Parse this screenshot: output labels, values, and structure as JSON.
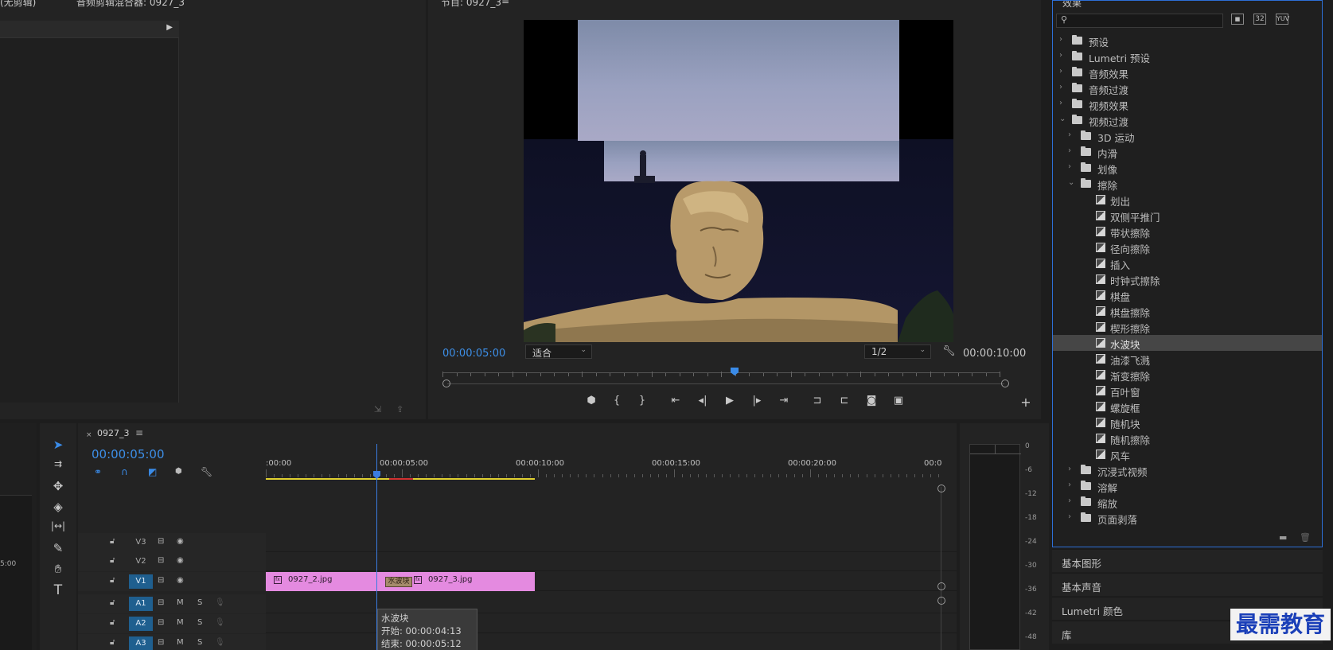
{
  "source": {
    "tab1": "(无剪辑)",
    "tab2": "音频剪辑混合器: 0927_3"
  },
  "program": {
    "title": "节目: 0927_3",
    "menu_icon": "≡",
    "timecode_current": "00:00:05:00",
    "timecode_duration": "00:00:10:00",
    "fit_label": "适合",
    "resolution_label": "1/2"
  },
  "effects": {
    "title": "效果",
    "search_placeholder": "",
    "tree": [
      {
        "label": "预设",
        "level": 0,
        "type": "folder",
        "expanded": false
      },
      {
        "label": "Lumetri 预设",
        "level": 0,
        "type": "folder",
        "expanded": false
      },
      {
        "label": "音频效果",
        "level": 0,
        "type": "folder",
        "expanded": false
      },
      {
        "label": "音频过渡",
        "level": 0,
        "type": "folder",
        "expanded": false
      },
      {
        "label": "视频效果",
        "level": 0,
        "type": "folder",
        "expanded": false
      },
      {
        "label": "视频过渡",
        "level": 0,
        "type": "folder",
        "expanded": true
      },
      {
        "label": "3D 运动",
        "level": 1,
        "type": "folder",
        "expanded": false
      },
      {
        "label": "内滑",
        "level": 1,
        "type": "folder",
        "expanded": false
      },
      {
        "label": "划像",
        "level": 1,
        "type": "folder",
        "expanded": false
      },
      {
        "label": "擦除",
        "level": 1,
        "type": "folder",
        "expanded": true
      },
      {
        "label": "划出",
        "level": 2,
        "type": "effect"
      },
      {
        "label": "双侧平推门",
        "level": 2,
        "type": "effect"
      },
      {
        "label": "带状擦除",
        "level": 2,
        "type": "effect"
      },
      {
        "label": "径向擦除",
        "level": 2,
        "type": "effect"
      },
      {
        "label": "插入",
        "level": 2,
        "type": "effect"
      },
      {
        "label": "时钟式擦除",
        "level": 2,
        "type": "effect"
      },
      {
        "label": "棋盘",
        "level": 2,
        "type": "effect"
      },
      {
        "label": "棋盘擦除",
        "level": 2,
        "type": "effect"
      },
      {
        "label": "楔形擦除",
        "level": 2,
        "type": "effect"
      },
      {
        "label": "水波块",
        "level": 2,
        "type": "effect",
        "selected": true
      },
      {
        "label": "油漆飞溅",
        "level": 2,
        "type": "effect"
      },
      {
        "label": "渐变擦除",
        "level": 2,
        "type": "effect"
      },
      {
        "label": "百叶窗",
        "level": 2,
        "type": "effect"
      },
      {
        "label": "螺旋框",
        "level": 2,
        "type": "effect"
      },
      {
        "label": "随机块",
        "level": 2,
        "type": "effect"
      },
      {
        "label": "随机擦除",
        "level": 2,
        "type": "effect"
      },
      {
        "label": "风车",
        "level": 2,
        "type": "effect"
      },
      {
        "label": "沉浸式视频",
        "level": 1,
        "type": "folder",
        "expanded": false
      },
      {
        "label": "溶解",
        "level": 1,
        "type": "folder",
        "expanded": false
      },
      {
        "label": "缩放",
        "level": 1,
        "type": "folder",
        "expanded": false
      },
      {
        "label": "页面剥落",
        "level": 1,
        "type": "folder",
        "expanded": false
      }
    ]
  },
  "side_panels": [
    "基本图形",
    "基本声音",
    "Lumetri 颜色",
    "库"
  ],
  "timeline": {
    "sequence_name": "0927_3",
    "timecode": "00:00:05:00",
    "ruler": [
      ":00:00",
      "00:00:05:00",
      "00:00:10:00",
      "00:00:15:00",
      "00:00:20:00",
      "00:0"
    ],
    "tracks": [
      {
        "name": "V3",
        "kind": "video",
        "active": false
      },
      {
        "name": "V2",
        "kind": "video",
        "active": false
      },
      {
        "name": "V1",
        "kind": "video",
        "active": true
      },
      {
        "name": "A1",
        "kind": "audio",
        "active": true
      },
      {
        "name": "A2",
        "kind": "audio",
        "active": true
      },
      {
        "name": "A3",
        "kind": "audio",
        "active": true
      }
    ],
    "clip1": "0927_2.jpg",
    "clip2": "0927_3.jpg",
    "transition_label": "水波块",
    "tooltip": {
      "name": "水波块",
      "start": "开始: 00:00:04:13",
      "end": "结束: 00:00:05:12"
    },
    "left_timecode_fragment": "5:00"
  },
  "meter": {
    "scale": [
      "0",
      "-6",
      "-12",
      "-18",
      "-24",
      "-30",
      "-36",
      "-42",
      "-48"
    ]
  },
  "audio_track_labels": {
    "mute": "M",
    "solo": "S"
  },
  "watermark": "最需教育",
  "colors": {
    "accent_blue": "#2d8ceb",
    "clip_pink": "#e48ae0",
    "playhead": "#3a7be0",
    "work_area": "#e0d030"
  }
}
